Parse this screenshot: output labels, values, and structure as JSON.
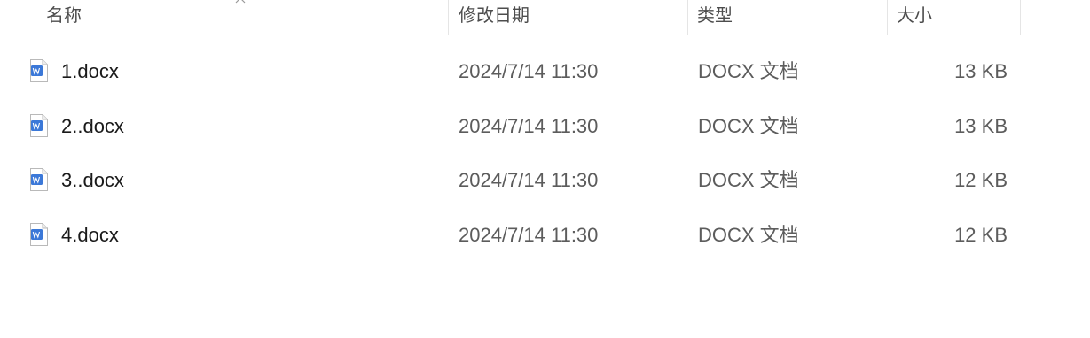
{
  "columns": {
    "name": "名称",
    "modified": "修改日期",
    "type": "类型",
    "size": "大小"
  },
  "files": [
    {
      "name": "1.docx",
      "modified": "2024/7/14 11:30",
      "type": "DOCX 文档",
      "size": "13 KB",
      "icon": "word-document-icon"
    },
    {
      "name": "2..docx",
      "modified": "2024/7/14 11:30",
      "type": "DOCX 文档",
      "size": "13 KB",
      "icon": "word-document-icon"
    },
    {
      "name": "3..docx",
      "modified": "2024/7/14 11:30",
      "type": "DOCX 文档",
      "size": "12 KB",
      "icon": "word-document-icon"
    },
    {
      "name": "4.docx",
      "modified": "2024/7/14 11:30",
      "type": "DOCX 文档",
      "size": "12 KB",
      "icon": "word-document-icon"
    }
  ],
  "colors": {
    "doc_icon_blue": "#3b78d8",
    "doc_icon_page": "#ffffff",
    "doc_icon_border": "#b9b9b9",
    "header_text": "#4d4d4d",
    "secondary_text": "#5c5c5c"
  }
}
